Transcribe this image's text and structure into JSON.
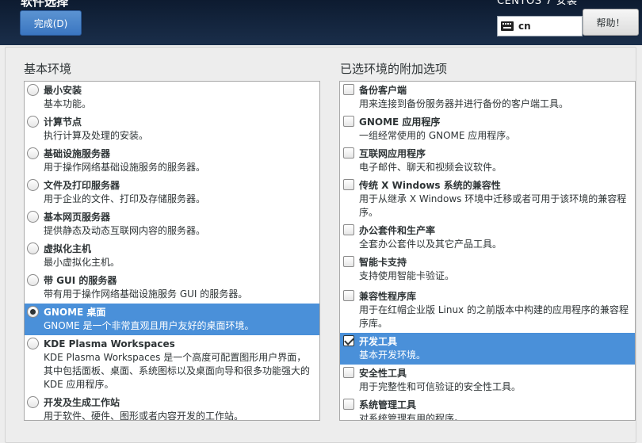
{
  "header": {
    "title": "软件选择",
    "done_label": "完成(D)",
    "install_title": "CENTOS 7 安装",
    "keyboard_layout": "cn",
    "help_label": "帮助！"
  },
  "base_env": {
    "title": "基本环境",
    "items": [
      {
        "name": "最小安装",
        "desc": "基本功能。",
        "checked": false
      },
      {
        "name": "计算节点",
        "desc": "执行计算及处理的安装。",
        "checked": false
      },
      {
        "name": "基础设施服务器",
        "desc": "用于操作网络基础设施服务的服务器。",
        "checked": false
      },
      {
        "name": "文件及打印服务器",
        "desc": "用于企业的文件、打印及存储服务器。",
        "checked": false
      },
      {
        "name": "基本网页服务器",
        "desc": "提供静态及动态互联网内容的服务器。",
        "checked": false
      },
      {
        "name": "虚拟化主机",
        "desc": "最小虚拟化主机。",
        "checked": false
      },
      {
        "name": "带 GUI 的服务器",
        "desc": "带有用于操作网络基础设施服务 GUI 的服务器。",
        "checked": false
      },
      {
        "name": "GNOME 桌面",
        "desc": "GNOME 是一个非常直观且用户友好的桌面环境。",
        "checked": true
      },
      {
        "name": "KDE Plasma Workspaces",
        "desc": "KDE Plasma Workspaces 是一个高度可配置图形用户界面，其中包括面板、桌面、系统图标以及桌面向导和很多功能强大的 KDE 应用程序。",
        "checked": false
      },
      {
        "name": "开发及生成工作站",
        "desc": "用于软件、硬件、图形或者内容开发的工作站。",
        "checked": false
      }
    ]
  },
  "addons": {
    "title": "已选环境的附加选项",
    "items": [
      {
        "name": "备份客户端",
        "desc": "用来连接到备份服务器并进行备份的客户端工具。",
        "checked": false
      },
      {
        "name": "GNOME 应用程序",
        "desc": "一组经常使用的 GNOME 应用程序。",
        "checked": false
      },
      {
        "name": "互联网应用程序",
        "desc": "电子邮件、聊天和视频会议软件。",
        "checked": false
      },
      {
        "name": "传统 X Windows 系统的兼容性",
        "desc": "用于从继承 X Windows 环境中迁移或者可用于该环境的兼容程序。",
        "checked": false
      },
      {
        "name": "办公套件和生产率",
        "desc": "全套办公套件以及其它产品工具。",
        "checked": false
      },
      {
        "name": "智能卡支持",
        "desc": "支持使用智能卡验证。",
        "checked": false
      },
      {
        "name": "兼容性程序库",
        "desc": "用于在红帽企业版 Linux 的之前版本中构建的应用程序的兼容程序库。",
        "checked": false
      },
      {
        "name": "开发工具",
        "desc": "基本开发环境。",
        "checked": true
      },
      {
        "name": "安全性工具",
        "desc": "用于完整性和可信验证的安全性工具。",
        "checked": false
      },
      {
        "name": "系统管理工具",
        "desc": "对系统管理有用的程序。",
        "checked": false
      }
    ]
  }
}
